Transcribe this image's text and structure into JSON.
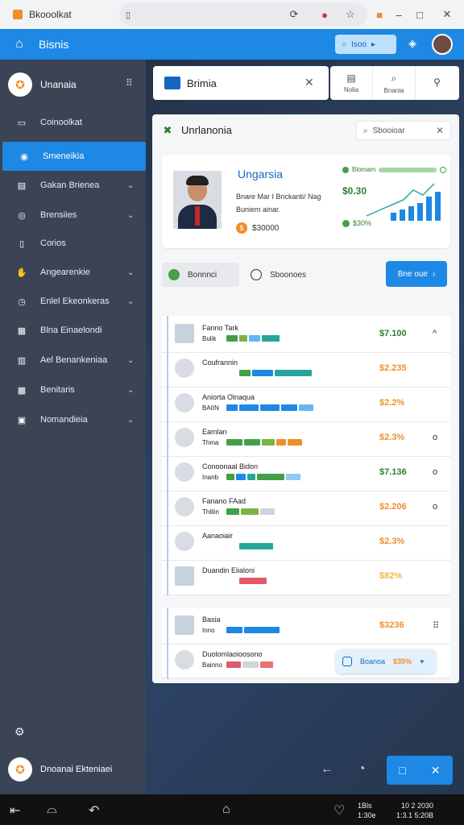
{
  "browser": {
    "tab_title": "Bkooolkat",
    "url_icon": "page-icon",
    "icons": [
      "reload-icon",
      "notification-icon",
      "star-icon",
      "tab-icon",
      "minimize-icon",
      "maximize-icon",
      "close-icon"
    ]
  },
  "appbar": {
    "title": "Bisnis",
    "search_label": "Isoo"
  },
  "sidebar": {
    "brand": "Unanaia",
    "items": [
      {
        "label": "Coinoolkat",
        "icon": "monitor-icon"
      },
      {
        "label": "Smeneikia",
        "icon": "palette-icon",
        "active": true
      },
      {
        "label": "Gakan Brienea",
        "icon": "chart-icon",
        "chevron": true
      },
      {
        "label": "Brensiies",
        "icon": "target-icon",
        "chevron": true
      },
      {
        "label": "Corios",
        "icon": "document-icon"
      },
      {
        "label": "Angearenkie",
        "icon": "hand-icon",
        "chevron": true
      },
      {
        "label": "Enlel Ekeonkeras",
        "icon": "clock-icon",
        "chevron": true
      },
      {
        "label": "Blna Einaelondi",
        "icon": "building-icon"
      },
      {
        "label": "Ael Benankeniaa",
        "icon": "table-icon",
        "chevron": true
      },
      {
        "label": "Benitaris",
        "icon": "grid-icon",
        "chevron": true
      },
      {
        "label": "Nomandieia",
        "icon": "card-icon",
        "chevron": true
      }
    ],
    "user": "Dnoanai Ekteniaei"
  },
  "topcard": {
    "title": "Brimia"
  },
  "top_tabs": [
    {
      "label": "Nolia",
      "icon": "document-icon"
    },
    {
      "label": "Bnania",
      "icon": "search-icon"
    },
    {
      "label": "",
      "icon": "user-icon"
    }
  ],
  "panel": {
    "title": "Unrlanonia",
    "search_placeholder": "Sbooioar",
    "profile": {
      "name": "Ungarsia",
      "description": "Bnare Mar I Bnckanti/ Nag Buniem ainar.",
      "price": "$30000",
      "stat_label": "Blomam",
      "big_value": "$0.30",
      "percent": "$30%"
    },
    "filters": {
      "chip1": "Bonnnci",
      "chip2": "Sboonoes",
      "button": "Bne oue"
    },
    "rows": [
      {
        "name": "Fanno Tark",
        "sub": "Bulik",
        "amount": "$7.100",
        "amount_color": "#2e7d32",
        "control": "^",
        "bars": [
          [
            "#43a047",
            14
          ],
          [
            "#7cb342",
            10
          ],
          [
            "#64b5f6",
            14
          ],
          [
            "#26a69a",
            22
          ]
        ],
        "flag": true
      },
      {
        "name": "Coufrannin",
        "sub": "",
        "amount": "$2.235",
        "amount_color": "#ef8f2a",
        "control": "",
        "bars": [
          [
            "#43a047",
            14
          ],
          [
            "#1e88e5",
            26
          ],
          [
            "#26a69a",
            46
          ]
        ]
      },
      {
        "name": "Aniorta Olnaqua",
        "sub": "BAIIN",
        "amount": "$2.2%",
        "amount_color": "#ef8f2a",
        "control": "",
        "bars": [
          [
            "#1e88e5",
            14
          ],
          [
            "#1e88e5",
            24
          ],
          [
            "#1e88e5",
            24
          ],
          [
            "#1e88e5",
            20
          ],
          [
            "#64b5f6",
            18
          ]
        ]
      },
      {
        "name": "Eamlan",
        "sub": "Thma",
        "amount": "$2.3%",
        "amount_color": "#ef8f2a",
        "control": "o",
        "bars": [
          [
            "#43a047",
            20
          ],
          [
            "#43a047",
            20
          ],
          [
            "#7cb342",
            16
          ],
          [
            "#ef8f2a",
            12
          ],
          [
            "#ef8f2a",
            18
          ]
        ]
      },
      {
        "name": "Conoonaal Bidon",
        "sub": "Inanb",
        "amount": "$7.136",
        "amount_color": "#2e7d32",
        "control": "o",
        "bars": [
          [
            "#43a047",
            10
          ],
          [
            "#1e88e5",
            12
          ],
          [
            "#26a69a",
            10
          ],
          [
            "#43a047",
            34
          ],
          [
            "#90caf9",
            18
          ]
        ]
      },
      {
        "name": "Fanano FAad",
        "sub": "Thlilin",
        "amount": "$2.206",
        "amount_color": "#ef8f2a",
        "control": "o",
        "bars": [
          [
            "#43a047",
            16
          ],
          [
            "#7cb342",
            22
          ],
          [
            "#d1d5db",
            18
          ]
        ]
      },
      {
        "name": "Aanaoiair",
        "sub": "",
        "amount": "$2.3%",
        "amount_color": "#ef8f2a",
        "control": "",
        "bars": [
          [
            "#26a69a",
            42
          ]
        ]
      },
      {
        "name": "Duandin Eiialoni",
        "sub": "",
        "amount": "$82%",
        "amount_color": "#f5b642",
        "control": "",
        "bars": [
          [
            "#e05a6b",
            34
          ]
        ],
        "flag": true
      }
    ],
    "rows2": [
      {
        "name": "Basia",
        "sub": "Inno",
        "amount": "$3236",
        "amount_color": "#ef8f2a",
        "control": "⠿",
        "bars": [
          [
            "#1e88e5",
            20
          ],
          [
            "#1e88e5",
            44
          ]
        ],
        "flag": true
      },
      {
        "name": "Duolomlaoioosono",
        "sub": "Bainno",
        "amount": "",
        "amount_color": "#ef8f2a",
        "control": "",
        "bars": [
          [
            "#e05a6b",
            18
          ],
          [
            "#d1d5db",
            20
          ],
          [
            "#e57373",
            16
          ]
        ]
      }
    ],
    "toast": {
      "label": "Boanoa",
      "value": "$35%"
    }
  },
  "bottom": {
    "clock_left": "1Bls\n1:30e",
    "clock_right": "10 2 2030\n1:3.1 5:20B"
  },
  "colors": {
    "accent": "#1e88e5",
    "sidebar": "#3a4454",
    "positive": "#2e7d32",
    "warning": "#ef8f2a"
  }
}
